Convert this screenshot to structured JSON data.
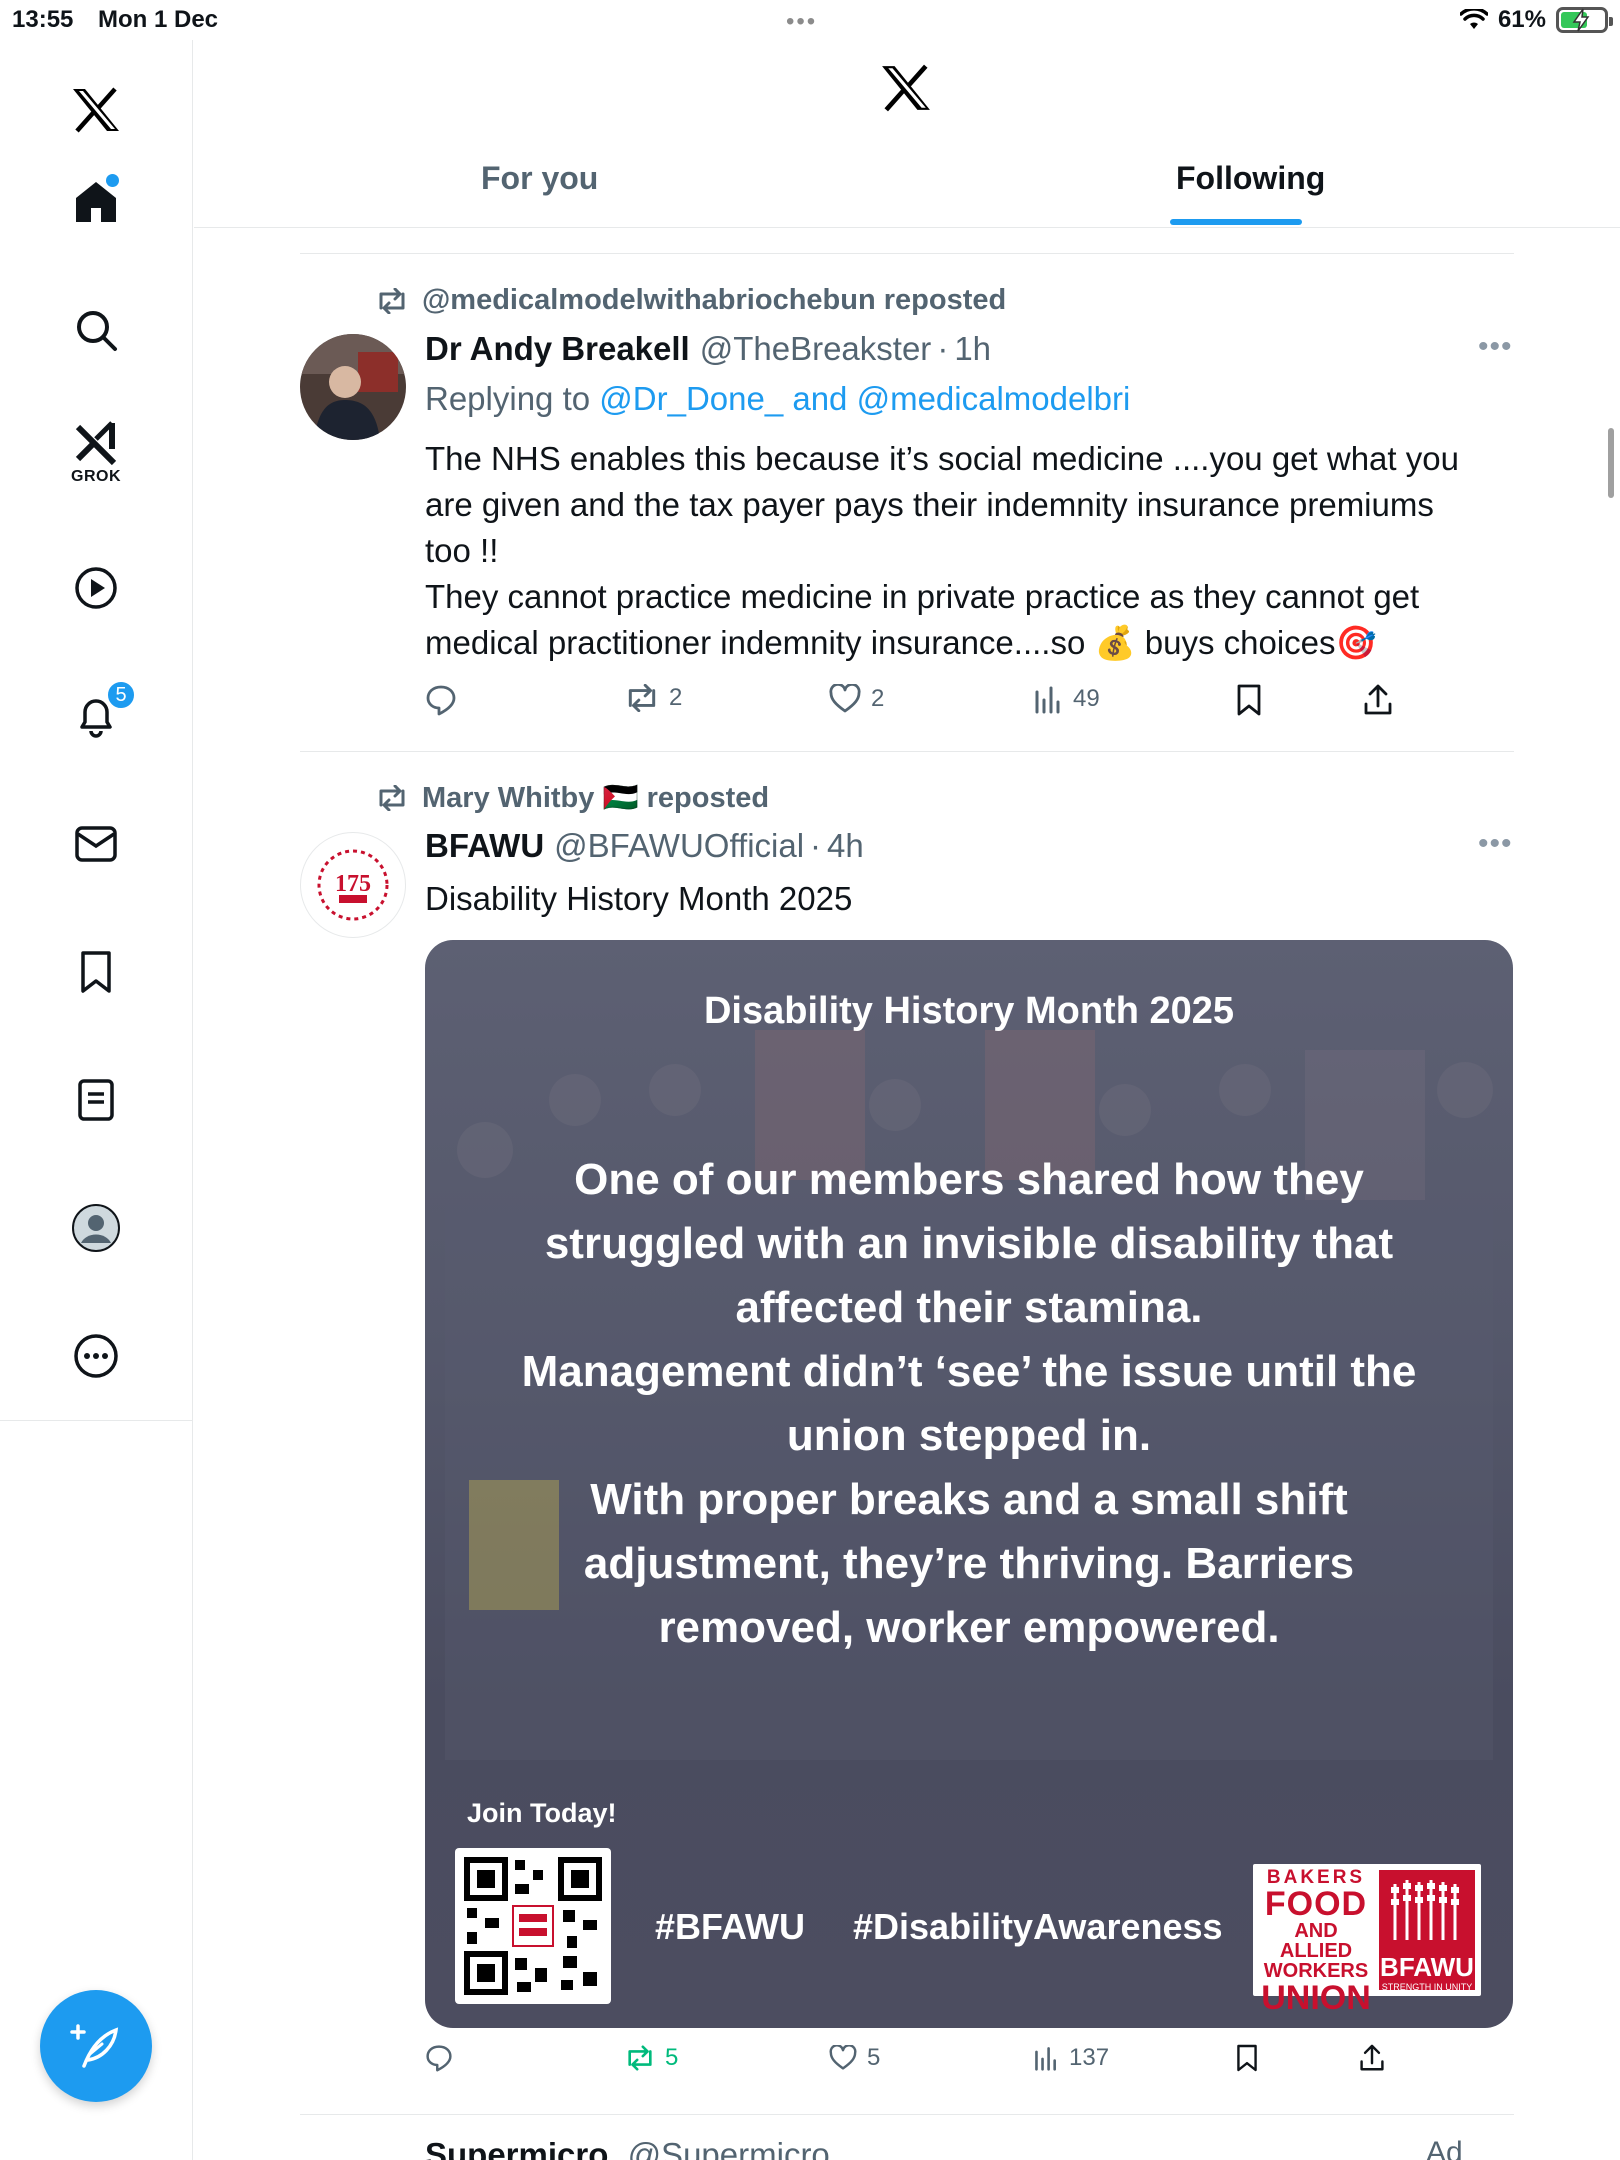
{
  "status_bar": {
    "time": "13:55",
    "date": "Mon 1 Dec",
    "battery": "61%",
    "battery_level": 0.61
  },
  "sidebar": {
    "items": [
      {
        "name": "home",
        "badge": ""
      },
      {
        "name": "search",
        "badge": ""
      },
      {
        "name": "grok",
        "label": "GROK"
      },
      {
        "name": "video"
      },
      {
        "name": "notifications",
        "badge": "5"
      },
      {
        "name": "messages"
      },
      {
        "name": "bookmarks"
      },
      {
        "name": "articles"
      },
      {
        "name": "profile"
      },
      {
        "name": "more"
      }
    ]
  },
  "header": {
    "tabs": [
      {
        "label": "For you",
        "active": false
      },
      {
        "label": "Following",
        "active": true
      }
    ]
  },
  "tweets": [
    {
      "repost_label": "@medicalmodelwithabriochebun reposted",
      "name": "Dr Andy Breakell",
      "handle": "@TheBreakster",
      "sep": "·",
      "time": "1h",
      "reply_prefix": "Replying to ",
      "reply_mentions": "@Dr_Done_ and @medicalmodelbri",
      "text_lines": [
        "The NHS enables this because it’s social medicine ....you get what you",
        "are given and the tax payer pays their indemnity insurance premiums",
        "too !!",
        "They cannot practice medicine in private practice as they cannot get",
        "medical practitioner indemnity insurance....so 💰 buys choices🎯"
      ],
      "stats": {
        "replies": "",
        "reposts": "2",
        "likes": "2",
        "views": "49"
      }
    },
    {
      "repost_label": "Mary Whitby 🇵🇸 reposted",
      "name": "BFAWU",
      "handle": "@BFAWUOfficial",
      "sep": "·",
      "time": "4h",
      "text": "Disability History Month 2025",
      "media": {
        "title": "Disability History Month 2025",
        "body_lines": [
          "One of our members shared how they",
          "struggled with an invisible disability that",
          "affected their stamina.",
          "Management didn’t ‘see’ the issue  until the",
          "union stepped in.",
          "With proper breaks and a small shift",
          "adjustment, they’re thriving. Barriers",
          "removed, worker empowered."
        ],
        "join": "Join Today!",
        "hashtag1": "#BFAWU",
        "hashtag2": "#DisabilityAwareness",
        "logo_lines": [
          "BAKERS",
          "FOOD",
          "AND ALLIED",
          "WORKERS",
          "UNION"
        ],
        "logo_brand": "BFAWU",
        "logo_tagline": "STRENGTH IN UNITY",
        "avatar_number": "175"
      },
      "stats": {
        "replies": "",
        "reposts": "5",
        "likes": "5",
        "views": "137"
      }
    }
  ],
  "teaser": {
    "name": "Supermicro",
    "handle": "@Supermicro",
    "ad": "Ad"
  },
  "colors": {
    "accent": "#1d9bf0",
    "repost_green": "#00ba7c",
    "secondary_text": "#536471",
    "brand_red": "#c8102e"
  }
}
